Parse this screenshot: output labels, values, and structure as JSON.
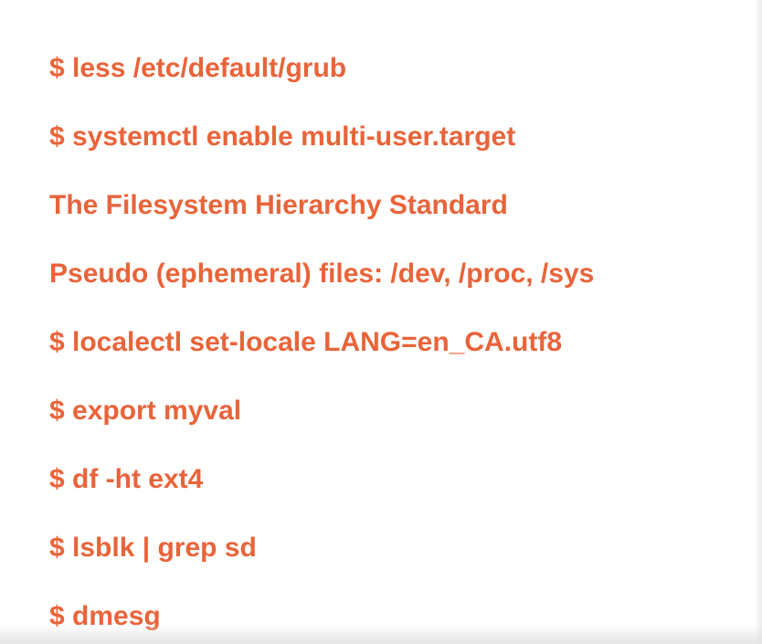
{
  "slide": {
    "accent_color": "#E8643A",
    "lines": [
      "$ less /etc/default/grub",
      "$ systemctl enable multi-user.target",
      "The Filesystem Hierarchy Standard",
      "Pseudo (ephemeral) files: /dev, /proc, /sys",
      "$ localectl set-locale LANG=en_CA.utf8",
      "$ export myval",
      "$ df -ht ext4",
      "$ lsblk | grep sd",
      "$ dmesg"
    ]
  }
}
